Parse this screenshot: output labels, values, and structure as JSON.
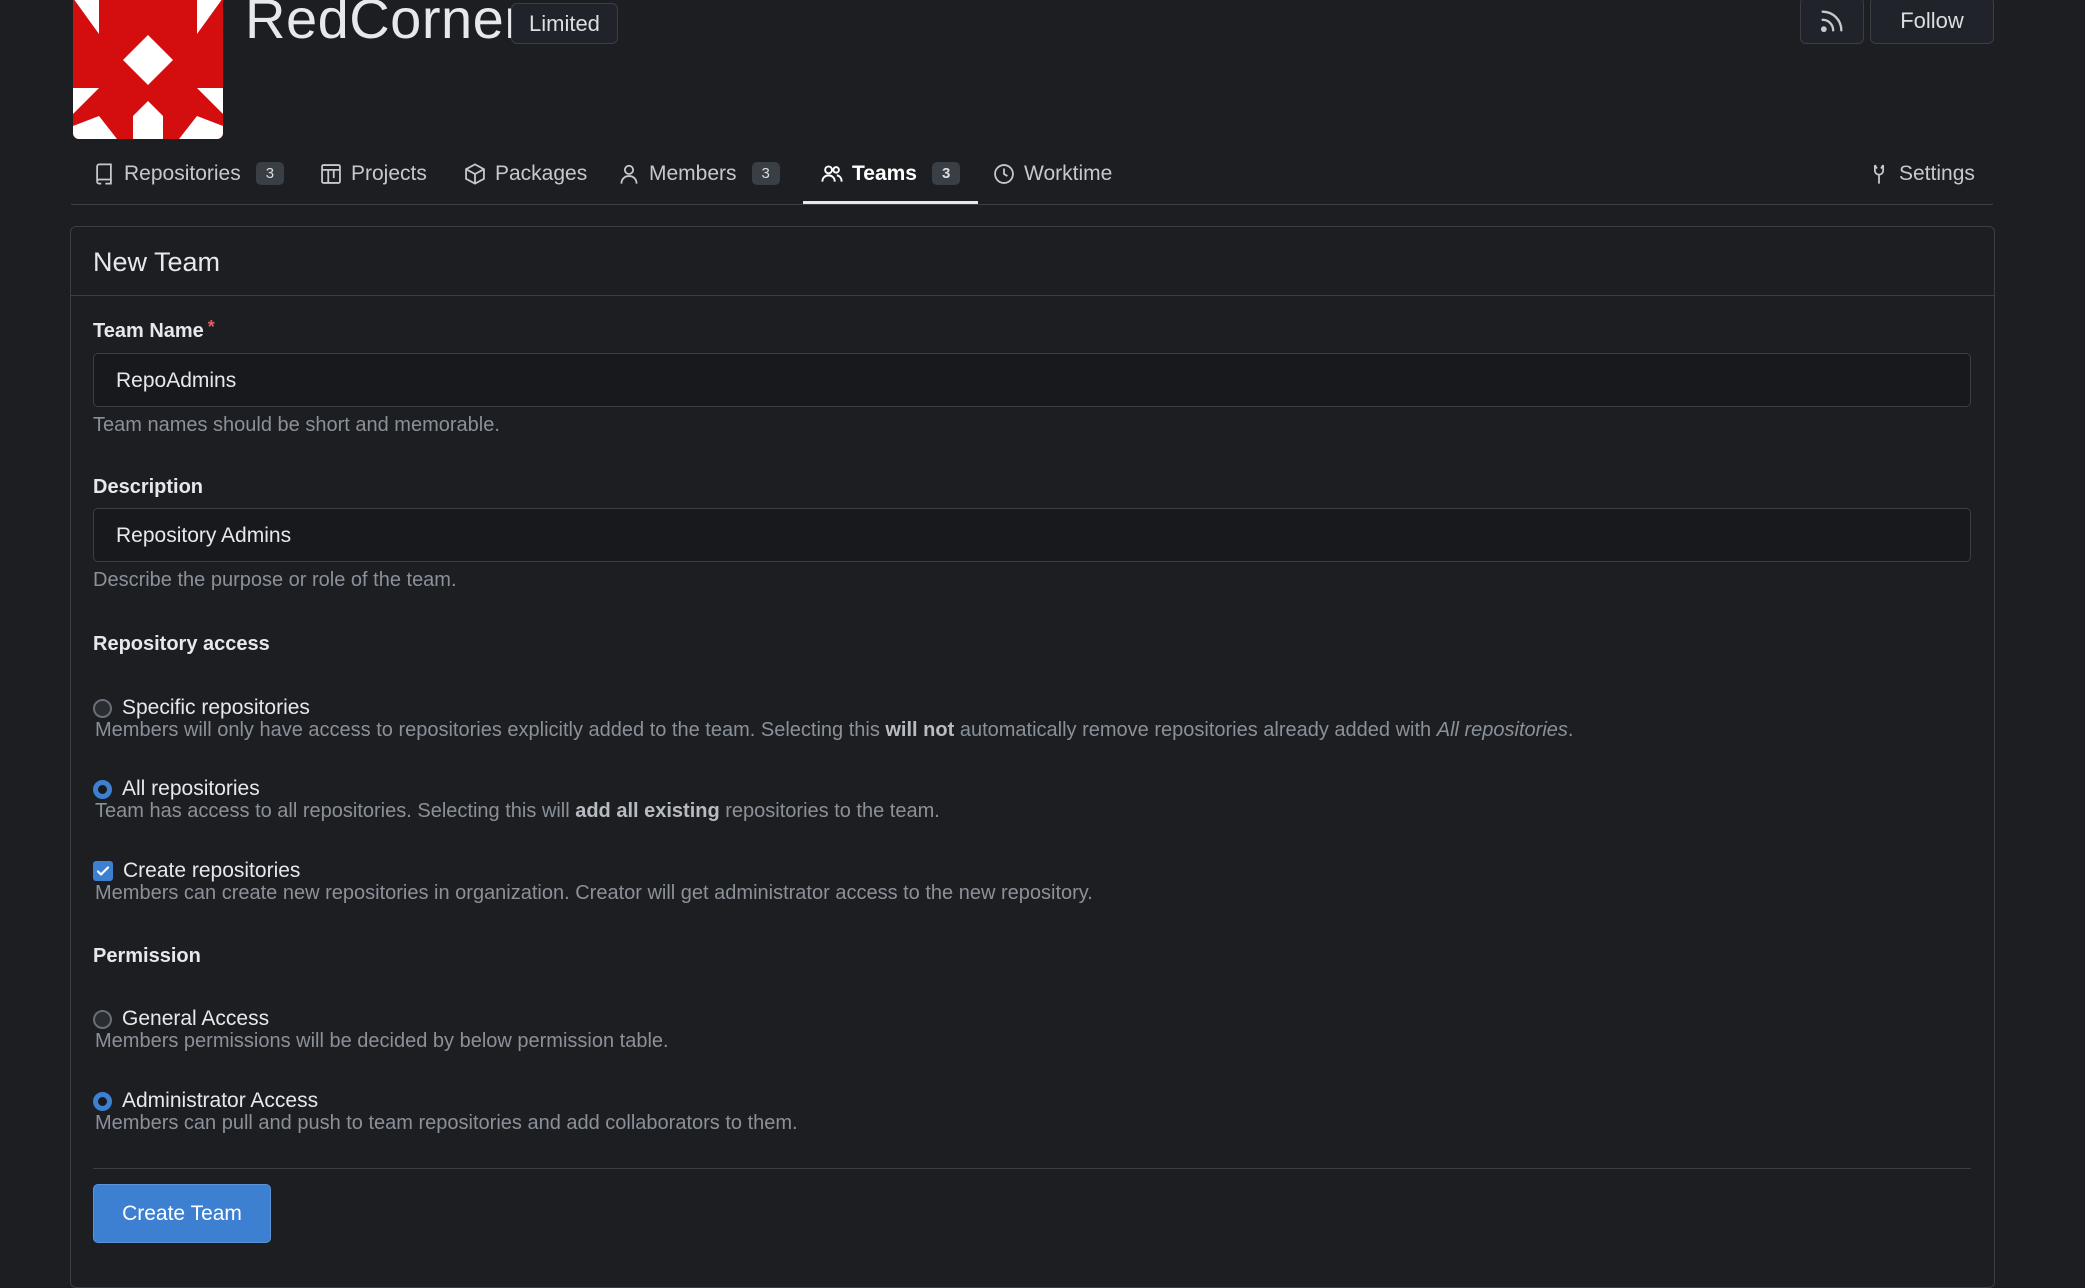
{
  "org": {
    "name": "RedCorner",
    "badge": "Limited",
    "follow_label": "Follow"
  },
  "tabs": [
    {
      "label": "Repositories",
      "count": "3"
    },
    {
      "label": "Projects"
    },
    {
      "label": "Packages"
    },
    {
      "label": "Members",
      "count": "3"
    },
    {
      "label": "Teams",
      "count": "3",
      "active": true
    },
    {
      "label": "Worktime"
    },
    {
      "label": "Settings"
    }
  ],
  "form": {
    "title": "New Team",
    "team_name": {
      "label": "Team Name",
      "required_mark": "*",
      "value": "RepoAdmins",
      "help": "Team names should be short and memorable."
    },
    "description": {
      "label": "Description",
      "value": "Repository Admins",
      "help": "Describe the purpose or role of the team."
    },
    "repo_access": {
      "label": "Repository access",
      "specific": {
        "label": "Specific repositories",
        "help_1": "Members will only have access to repositories explicitly added to the team. Selecting this ",
        "help_bold": "will not",
        "help_2": " automatically remove repositories already added with ",
        "help_italic": "All repositories",
        "help_3": ".",
        "selected": false
      },
      "all": {
        "label": "All repositories",
        "help_1": "Team has access to all repositories. Selecting this will ",
        "help_bold": "add all existing",
        "help_2": " repositories to the team.",
        "selected": true
      },
      "create": {
        "label": "Create repositories",
        "help": "Members can create new repositories in organization. Creator will get administrator access to the new repository.",
        "checked": true
      }
    },
    "permission": {
      "label": "Permission",
      "general": {
        "label": "General Access",
        "help": "Members permissions will be decided by below permission table.",
        "selected": false
      },
      "admin": {
        "label": "Administrator Access",
        "help": "Members can pull and push to team repositories and add collaborators to them.",
        "selected": true
      }
    },
    "submit_label": "Create Team"
  },
  "colors": {
    "background": "#1c1e22",
    "accent": "#3d7fd0",
    "logo": "#d40e0e",
    "border": "#3a3e45"
  }
}
